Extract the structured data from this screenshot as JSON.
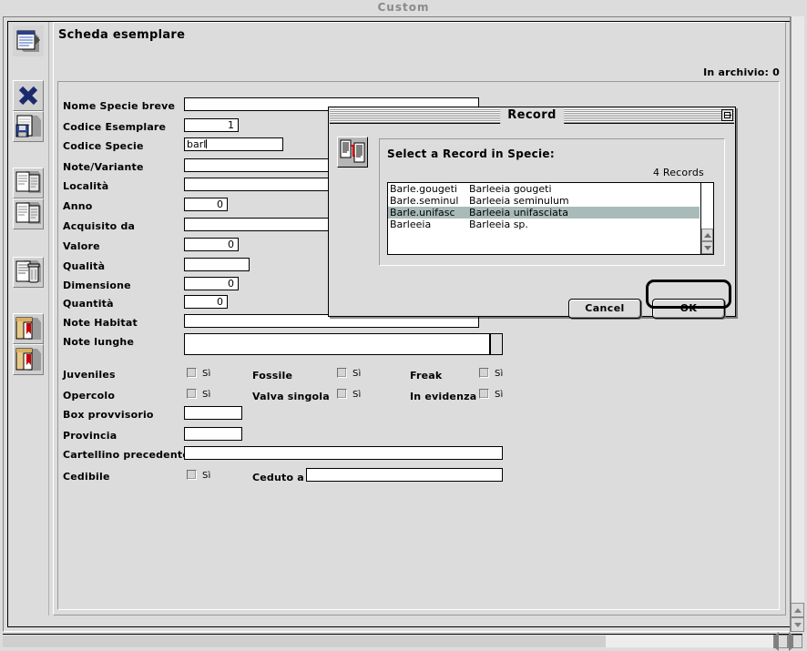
{
  "window": {
    "title": "Custom"
  },
  "toolbar": {
    "buttons": [
      {
        "name": "record-card-icon",
        "label": "Scheda"
      },
      {
        "name": "close-x-icon",
        "label": "Chiudi"
      },
      {
        "name": "save-disk-icon",
        "label": "Salva"
      },
      {
        "name": "new-record-icon",
        "label": "Nuovo record"
      },
      {
        "name": "duplicate-record-icon",
        "label": "Duplica record"
      },
      {
        "name": "delete-trash-icon",
        "label": "Elimina"
      },
      {
        "name": "previous-record-icon",
        "label": "Record precedente"
      },
      {
        "name": "next-record-icon",
        "label": "Record successivo"
      }
    ]
  },
  "panel": {
    "title": "Scheda esemplare",
    "archive_status": "In archivio: 0"
  },
  "form": {
    "fields": [
      {
        "label": "Nome Specie breve",
        "value": "",
        "type": "text"
      },
      {
        "label": "Codice Esemplare",
        "value": "1",
        "type": "number"
      },
      {
        "label": "Codice Specie",
        "value": "barl",
        "type": "text"
      },
      {
        "label": "Note/Variante",
        "value": "",
        "type": "text"
      },
      {
        "label": "Località",
        "value": "",
        "type": "text"
      },
      {
        "label": "Anno",
        "value": "0",
        "type": "number"
      },
      {
        "label": "Acquisito da",
        "value": "",
        "type": "text"
      },
      {
        "label": "Valore",
        "value": "0",
        "type": "number"
      },
      {
        "label": "Qualità",
        "value": "",
        "type": "text"
      },
      {
        "label": "Dimensione",
        "value": "0",
        "type": "number"
      },
      {
        "label": "Quantità",
        "value": "0",
        "type": "number"
      },
      {
        "label": "Note Habitat",
        "value": "",
        "type": "text"
      },
      {
        "label": "Note lunghe",
        "value": "",
        "type": "textarea"
      },
      {
        "label": "Box provvisorio",
        "value": "",
        "type": "text"
      },
      {
        "label": "Provincia",
        "value": "",
        "type": "text"
      },
      {
        "label": "Cartellino precedente",
        "value": "",
        "type": "text"
      }
    ],
    "checkboxes": [
      {
        "label": "Juveniles",
        "yes": "Sì",
        "checked": false
      },
      {
        "label": "Opercolo",
        "yes": "Sì",
        "checked": false
      },
      {
        "label": "Fossile",
        "yes": "Sì",
        "checked": false
      },
      {
        "label": "Valva singola",
        "yes": "Sì",
        "checked": false
      },
      {
        "label": "Freak",
        "yes": "Sì",
        "checked": false
      },
      {
        "label": "In evidenza",
        "yes": "Sì",
        "checked": false
      },
      {
        "label": "Cedibile",
        "yes": "Sì",
        "checked": false
      }
    ],
    "ceduto_a": {
      "label": "Ceduto a",
      "value": ""
    }
  },
  "dialog": {
    "title": "Record",
    "prompt": "Select a Record in Specie:",
    "count": "4 Records",
    "icon": "record-list-icon",
    "collapse_icon": "collapse-box-icon",
    "rows": [
      {
        "code": "Barle.gougeti",
        "name": "Barleeia gougeti",
        "selected": false
      },
      {
        "code": "Barle.seminul",
        "name": "Barleeia seminulum",
        "selected": false
      },
      {
        "code": "Barle.unifasc",
        "name": "Barleeia unifasciata",
        "selected": true
      },
      {
        "code": "Barleeia",
        "name": "Barleeia sp.",
        "selected": false
      }
    ],
    "cancel_label": "Cancel",
    "ok_label": "OK"
  },
  "colors": {
    "window_bg": "#dcdcdc",
    "field_bg": "#ffffff",
    "selection": "#a9bbb9",
    "border": "#000000",
    "title_text": "#8a8a8a"
  }
}
